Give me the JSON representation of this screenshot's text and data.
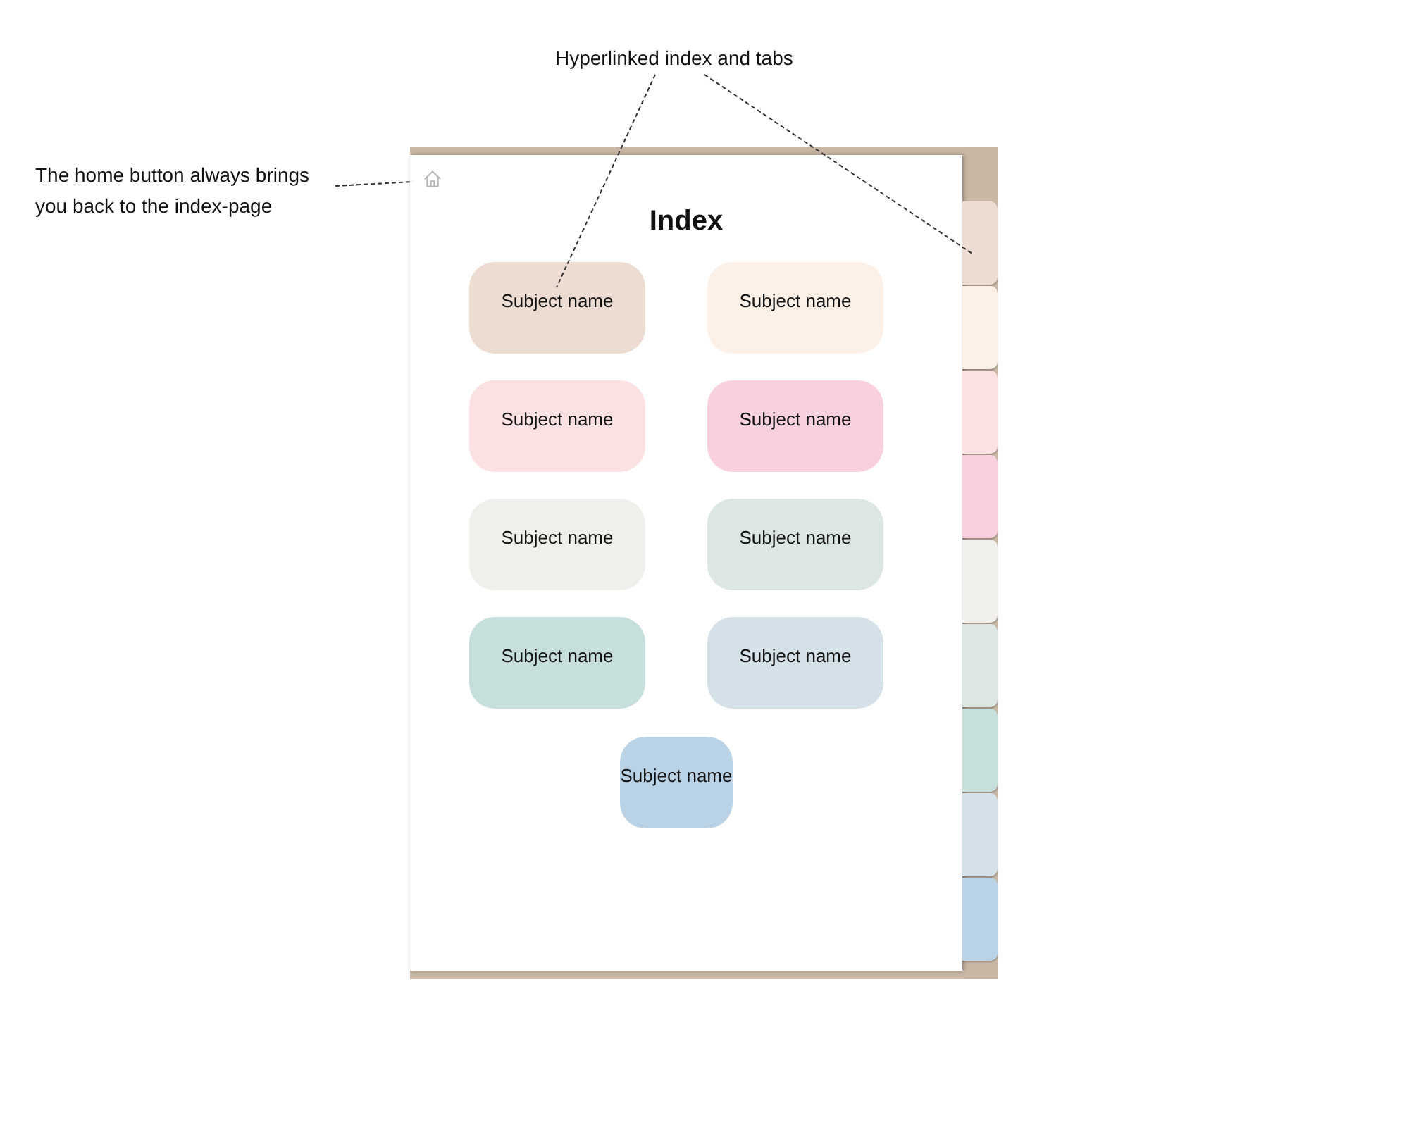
{
  "annotations": [
    {
      "kind": "top",
      "text": "Hyperlinked index and tabs"
    },
    {
      "kind": "left",
      "text": "The home button always brings you back to the index-page"
    }
  ],
  "page": {
    "title": "Index",
    "subjects": [
      {
        "label": "Subject name",
        "color": "#ecdcd1"
      },
      {
        "label": "Subject name",
        "color": "#fdf0e6"
      },
      {
        "label": "Subject name",
        "color": "#fce1e3"
      },
      {
        "label": "Subject name",
        "color": "#f9d0e0"
      },
      {
        "label": "Subject name",
        "color": "#f0efeb"
      },
      {
        "label": "Subject name",
        "color": "#dce6e3"
      },
      {
        "label": "Subject name",
        "color": "#c6dfdd"
      },
      {
        "label": "Subject name",
        "color": "#d4e1e9"
      },
      {
        "label": "Subject name",
        "color": "#bad2e6"
      }
    ],
    "tabs": [
      {
        "color": "#ecdcd1"
      },
      {
        "color": "#fdf0e6"
      },
      {
        "color": "#fce1e3"
      },
      {
        "color": "#f9d0e0"
      },
      {
        "color": "#f0efeb"
      },
      {
        "color": "#dce6e3"
      },
      {
        "color": "#c6dfdd"
      },
      {
        "color": "#d4e1e9"
      },
      {
        "color": "#bad2e6"
      }
    ]
  }
}
